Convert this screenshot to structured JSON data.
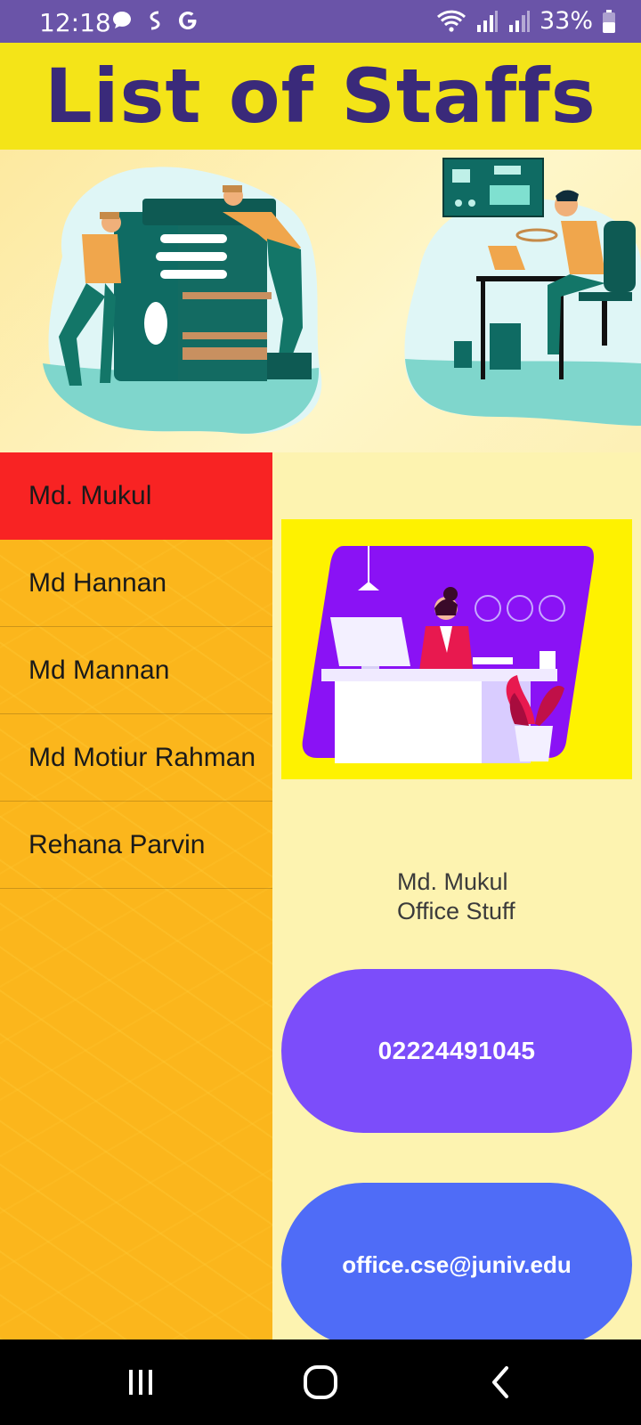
{
  "status_bar": {
    "time": "12:18",
    "battery": "33%",
    "icons": [
      "chat-icon",
      "s-app-icon",
      "google-icon",
      "wifi-icon",
      "signal-icon",
      "signal-icon",
      "battery-icon"
    ]
  },
  "header": {
    "title": "List of Staffs"
  },
  "staff_list": [
    {
      "name": "Md. Mukul"
    },
    {
      "name": "Md Hannan"
    },
    {
      "name": "Md Mannan"
    },
    {
      "name": "Md Motiur Rahman"
    },
    {
      "name": "Rehana Parvin"
    }
  ],
  "selected": {
    "name": "Md. Mukul",
    "role": "Office Stuff",
    "phone": "02224491045",
    "email": "office.cse@juniv.edu"
  },
  "colors": {
    "status_bar": "#6a54a8",
    "header_bg": "#f4e418",
    "header_text": "#3a2a7a",
    "list_bg": "#fbb61c",
    "active_item": "#f82323",
    "phone_button": "#7c4dfa",
    "email_button": "#4f6cf7"
  },
  "nav": {
    "icons": [
      "recents-icon",
      "home-icon",
      "back-icon"
    ]
  }
}
